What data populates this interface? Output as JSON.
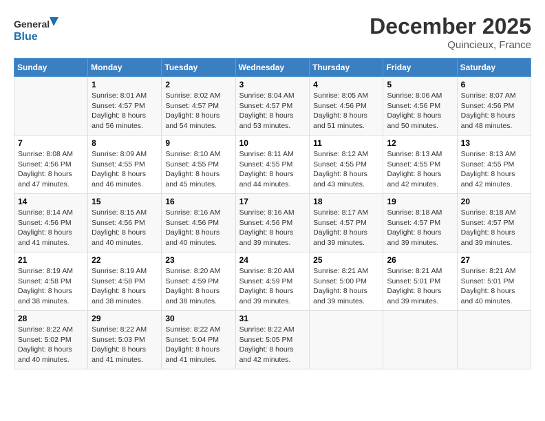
{
  "header": {
    "logo_text_general": "General",
    "logo_text_blue": "Blue",
    "month_title": "December 2025",
    "location": "Quincieux, France"
  },
  "days_of_week": [
    "Sunday",
    "Monday",
    "Tuesday",
    "Wednesday",
    "Thursday",
    "Friday",
    "Saturday"
  ],
  "weeks": [
    [
      {
        "day": "",
        "info": ""
      },
      {
        "day": "1",
        "info": "Sunrise: 8:01 AM\nSunset: 4:57 PM\nDaylight: 8 hours\nand 56 minutes."
      },
      {
        "day": "2",
        "info": "Sunrise: 8:02 AM\nSunset: 4:57 PM\nDaylight: 8 hours\nand 54 minutes."
      },
      {
        "day": "3",
        "info": "Sunrise: 8:04 AM\nSunset: 4:57 PM\nDaylight: 8 hours\nand 53 minutes."
      },
      {
        "day": "4",
        "info": "Sunrise: 8:05 AM\nSunset: 4:56 PM\nDaylight: 8 hours\nand 51 minutes."
      },
      {
        "day": "5",
        "info": "Sunrise: 8:06 AM\nSunset: 4:56 PM\nDaylight: 8 hours\nand 50 minutes."
      },
      {
        "day": "6",
        "info": "Sunrise: 8:07 AM\nSunset: 4:56 PM\nDaylight: 8 hours\nand 48 minutes."
      }
    ],
    [
      {
        "day": "7",
        "info": "Sunrise: 8:08 AM\nSunset: 4:56 PM\nDaylight: 8 hours\nand 47 minutes."
      },
      {
        "day": "8",
        "info": "Sunrise: 8:09 AM\nSunset: 4:55 PM\nDaylight: 8 hours\nand 46 minutes."
      },
      {
        "day": "9",
        "info": "Sunrise: 8:10 AM\nSunset: 4:55 PM\nDaylight: 8 hours\nand 45 minutes."
      },
      {
        "day": "10",
        "info": "Sunrise: 8:11 AM\nSunset: 4:55 PM\nDaylight: 8 hours\nand 44 minutes."
      },
      {
        "day": "11",
        "info": "Sunrise: 8:12 AM\nSunset: 4:55 PM\nDaylight: 8 hours\nand 43 minutes."
      },
      {
        "day": "12",
        "info": "Sunrise: 8:13 AM\nSunset: 4:55 PM\nDaylight: 8 hours\nand 42 minutes."
      },
      {
        "day": "13",
        "info": "Sunrise: 8:13 AM\nSunset: 4:55 PM\nDaylight: 8 hours\nand 42 minutes."
      }
    ],
    [
      {
        "day": "14",
        "info": "Sunrise: 8:14 AM\nSunset: 4:56 PM\nDaylight: 8 hours\nand 41 minutes."
      },
      {
        "day": "15",
        "info": "Sunrise: 8:15 AM\nSunset: 4:56 PM\nDaylight: 8 hours\nand 40 minutes."
      },
      {
        "day": "16",
        "info": "Sunrise: 8:16 AM\nSunset: 4:56 PM\nDaylight: 8 hours\nand 40 minutes."
      },
      {
        "day": "17",
        "info": "Sunrise: 8:16 AM\nSunset: 4:56 PM\nDaylight: 8 hours\nand 39 minutes."
      },
      {
        "day": "18",
        "info": "Sunrise: 8:17 AM\nSunset: 4:57 PM\nDaylight: 8 hours\nand 39 minutes."
      },
      {
        "day": "19",
        "info": "Sunrise: 8:18 AM\nSunset: 4:57 PM\nDaylight: 8 hours\nand 39 minutes."
      },
      {
        "day": "20",
        "info": "Sunrise: 8:18 AM\nSunset: 4:57 PM\nDaylight: 8 hours\nand 39 minutes."
      }
    ],
    [
      {
        "day": "21",
        "info": "Sunrise: 8:19 AM\nSunset: 4:58 PM\nDaylight: 8 hours\nand 38 minutes."
      },
      {
        "day": "22",
        "info": "Sunrise: 8:19 AM\nSunset: 4:58 PM\nDaylight: 8 hours\nand 38 minutes."
      },
      {
        "day": "23",
        "info": "Sunrise: 8:20 AM\nSunset: 4:59 PM\nDaylight: 8 hours\nand 38 minutes."
      },
      {
        "day": "24",
        "info": "Sunrise: 8:20 AM\nSunset: 4:59 PM\nDaylight: 8 hours\nand 39 minutes."
      },
      {
        "day": "25",
        "info": "Sunrise: 8:21 AM\nSunset: 5:00 PM\nDaylight: 8 hours\nand 39 minutes."
      },
      {
        "day": "26",
        "info": "Sunrise: 8:21 AM\nSunset: 5:01 PM\nDaylight: 8 hours\nand 39 minutes."
      },
      {
        "day": "27",
        "info": "Sunrise: 8:21 AM\nSunset: 5:01 PM\nDaylight: 8 hours\nand 40 minutes."
      }
    ],
    [
      {
        "day": "28",
        "info": "Sunrise: 8:22 AM\nSunset: 5:02 PM\nDaylight: 8 hours\nand 40 minutes."
      },
      {
        "day": "29",
        "info": "Sunrise: 8:22 AM\nSunset: 5:03 PM\nDaylight: 8 hours\nand 41 minutes."
      },
      {
        "day": "30",
        "info": "Sunrise: 8:22 AM\nSunset: 5:04 PM\nDaylight: 8 hours\nand 41 minutes."
      },
      {
        "day": "31",
        "info": "Sunrise: 8:22 AM\nSunset: 5:05 PM\nDaylight: 8 hours\nand 42 minutes."
      },
      {
        "day": "",
        "info": ""
      },
      {
        "day": "",
        "info": ""
      },
      {
        "day": "",
        "info": ""
      }
    ]
  ]
}
